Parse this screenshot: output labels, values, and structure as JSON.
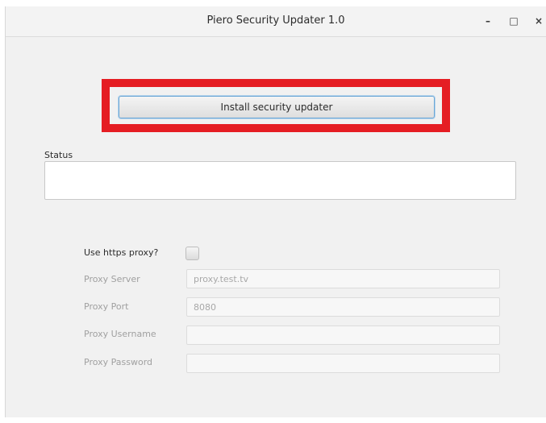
{
  "window": {
    "title": "Piero Security Updater 1.0",
    "minimize_glyph": "–",
    "maximize_glyph": "□",
    "close_glyph": "×"
  },
  "main": {
    "install_button_label": "Install security updater",
    "highlight_color": "#e51d23",
    "status_label": "Status",
    "status_value": ""
  },
  "proxy": {
    "use_proxy_label": "Use https proxy?",
    "use_proxy_checked": false,
    "fields": [
      {
        "label": "Proxy Server",
        "value": "proxy.test.tv"
      },
      {
        "label": "Proxy Port",
        "value": "8080"
      },
      {
        "label": "Proxy Username",
        "value": ""
      },
      {
        "label": "Proxy Password",
        "value": ""
      }
    ]
  }
}
